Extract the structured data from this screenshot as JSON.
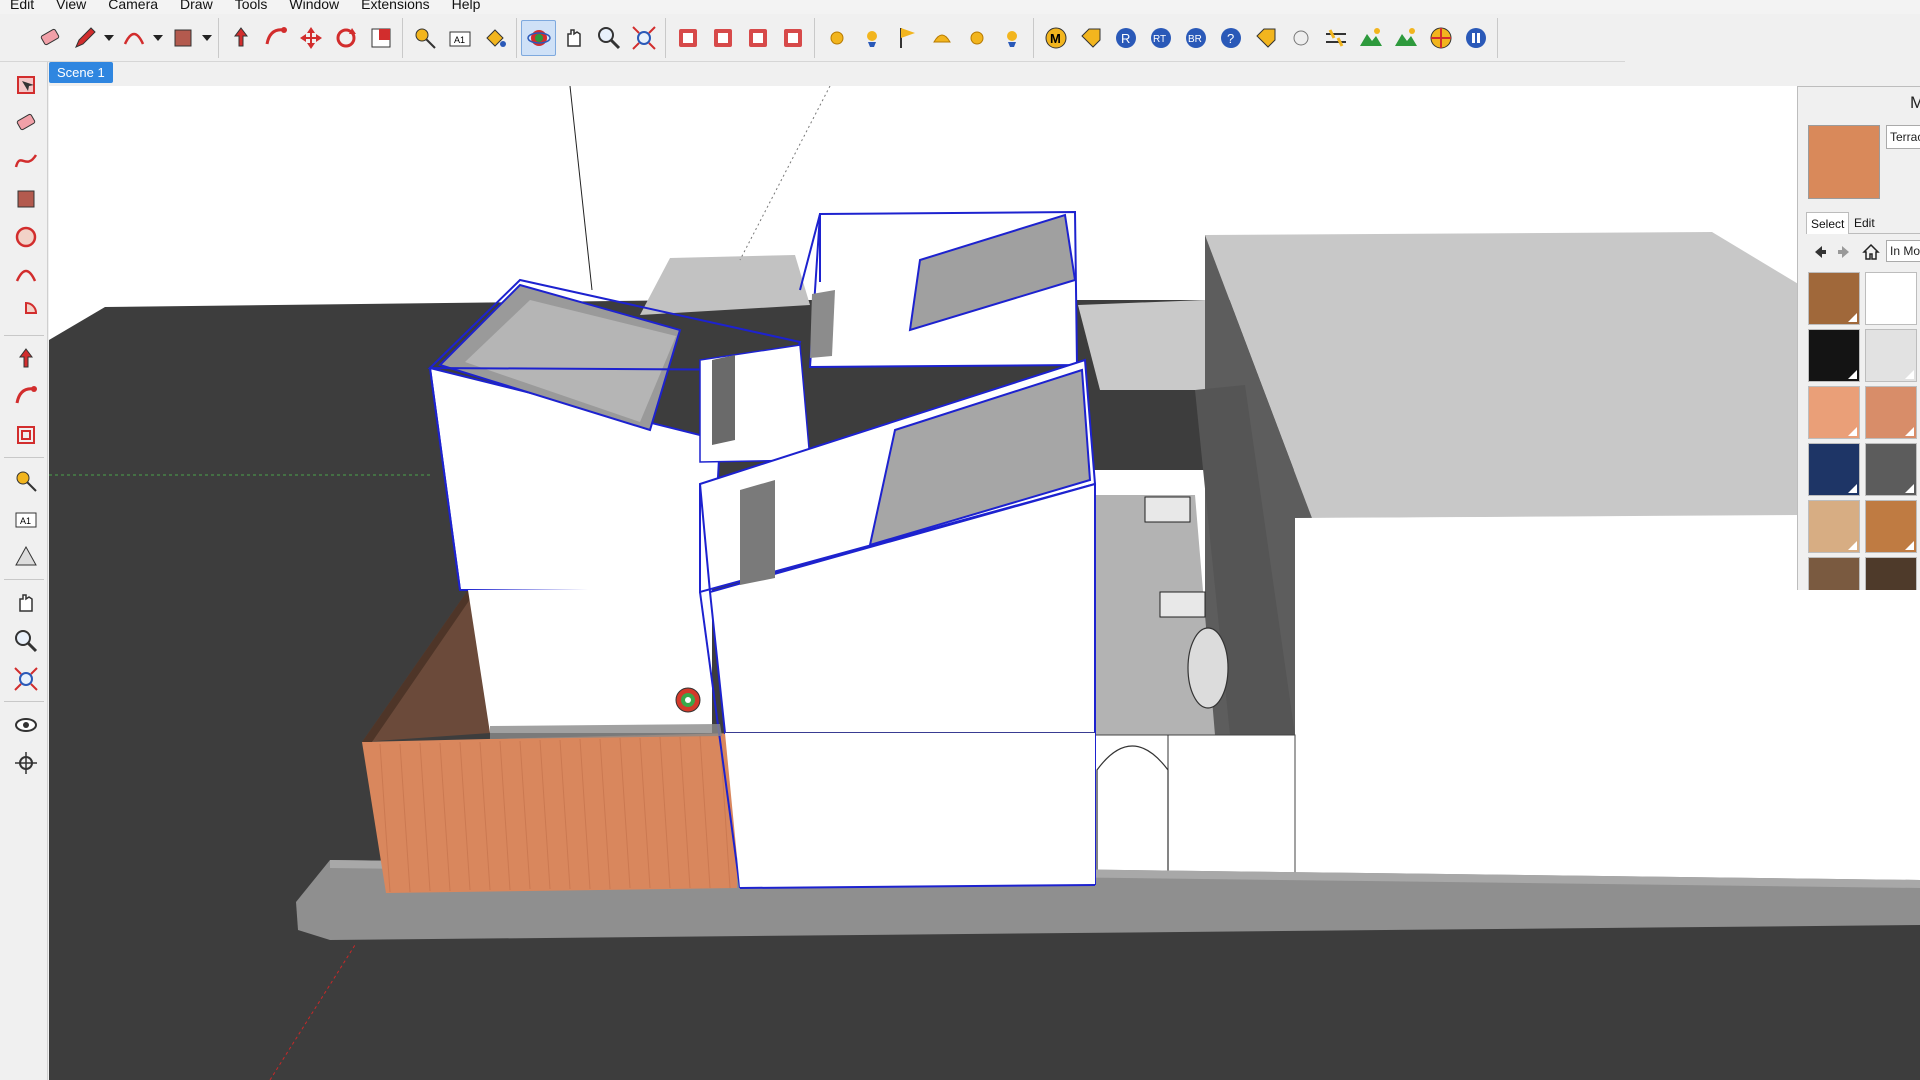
{
  "menu": [
    "Edit",
    "View",
    "Camera",
    "Draw",
    "Tools",
    "Window",
    "Extensions",
    "Help"
  ],
  "toolbar_top": [
    {
      "name": "eraser-icon",
      "active": false
    },
    {
      "name": "pencil-icon",
      "active": false,
      "dropdown": true
    },
    {
      "name": "arc-icon",
      "active": false,
      "dropdown": true
    },
    {
      "name": "rectangle-icon",
      "active": false,
      "dropdown": true
    },
    {
      "name": "push-pull-icon",
      "active": false
    },
    {
      "name": "follow-me-icon",
      "active": false
    },
    {
      "name": "move-icon",
      "active": false
    },
    {
      "name": "rotate-icon",
      "active": false
    },
    {
      "name": "scale-icon",
      "active": false
    },
    {
      "name": "tape-measure-icon",
      "active": false
    },
    {
      "name": "text-icon",
      "active": false
    },
    {
      "name": "paint-bucket-icon",
      "active": false
    },
    {
      "name": "orbit-icon",
      "active": true
    },
    {
      "name": "pan-icon",
      "active": false
    },
    {
      "name": "zoom-icon",
      "active": false
    },
    {
      "name": "zoom-extents-icon",
      "active": false
    },
    {
      "name": "3d-warehouse-icon",
      "active": false
    },
    {
      "name": "extension-warehouse-icon",
      "active": false
    },
    {
      "name": "layout-icon",
      "active": false
    },
    {
      "name": "send-to-layout-icon",
      "active": false
    },
    {
      "name": "sphere-yellow-icon",
      "active": false
    },
    {
      "name": "light-icon",
      "active": false
    },
    {
      "name": "flag-icon",
      "active": false
    },
    {
      "name": "dome-light-icon",
      "active": false
    },
    {
      "name": "orb-icon",
      "active": false
    },
    {
      "name": "spotlight-icon",
      "active": false
    },
    {
      "name": "render-m-icon",
      "active": false
    },
    {
      "name": "material-tag-icon",
      "active": false
    },
    {
      "name": "render-r-icon",
      "active": false
    },
    {
      "name": "render-rt-icon",
      "active": false
    },
    {
      "name": "render-br-icon",
      "active": false
    },
    {
      "name": "help-icon",
      "active": false
    },
    {
      "name": "label-tag-icon",
      "active": false
    },
    {
      "name": "white-sphere-icon",
      "active": false
    },
    {
      "name": "settings-sliders-icon",
      "active": false
    },
    {
      "name": "landscape-icon",
      "active": false
    },
    {
      "name": "landscape-export-icon",
      "active": false
    },
    {
      "name": "target-icon",
      "active": false
    },
    {
      "name": "pause-icon",
      "active": false
    }
  ],
  "toolbar_left": [
    "select-box-icon",
    "eraser-icon",
    "freehand-icon",
    "rectangle-icon",
    "circle-icon",
    "arc-icon",
    "pie-icon",
    "push-pull-icon",
    "follow-me-icon",
    "offset-icon",
    "tape-measure-icon",
    "dimension-text-icon",
    "protractor-icon",
    "pan-icon",
    "zoom-window-icon",
    "zoom-extents-icon",
    "look-around-icon",
    "position-camera-icon"
  ],
  "scene": {
    "tab_label": "Scene 1"
  },
  "materials": {
    "title": "M",
    "current_name": "Terrac",
    "current_color": "#d9895a",
    "tab_select": "Select",
    "tab_edit": "Edit",
    "collection": "In Mo",
    "swatches": [
      {
        "name": "wood-oak",
        "color": "#a0683a"
      },
      {
        "name": "white",
        "color": "#ffffff"
      },
      {
        "name": "black",
        "color": "#141414"
      },
      {
        "name": "light-gray",
        "color": "#e2e2e2"
      },
      {
        "name": "terracotta",
        "color": "#ea9f78"
      },
      {
        "name": "terracotta-textured",
        "color": "#d88d69"
      },
      {
        "name": "navy",
        "color": "#1e3566"
      },
      {
        "name": "dark-gray",
        "color": "#5c5c5c"
      },
      {
        "name": "tan",
        "color": "#d7ad83"
      },
      {
        "name": "wood-light",
        "color": "#bf7b42"
      },
      {
        "name": "wood-dark-brown",
        "color": "#7a5a40"
      },
      {
        "name": "dark-brown",
        "color": "#4e3a2a"
      }
    ]
  },
  "model": {
    "selection_color": "#1d22cf",
    "ground_color": "#3d3d3d",
    "wall_brick_color": "#d9875d",
    "wall_brown_color": "#6b4a3a"
  }
}
